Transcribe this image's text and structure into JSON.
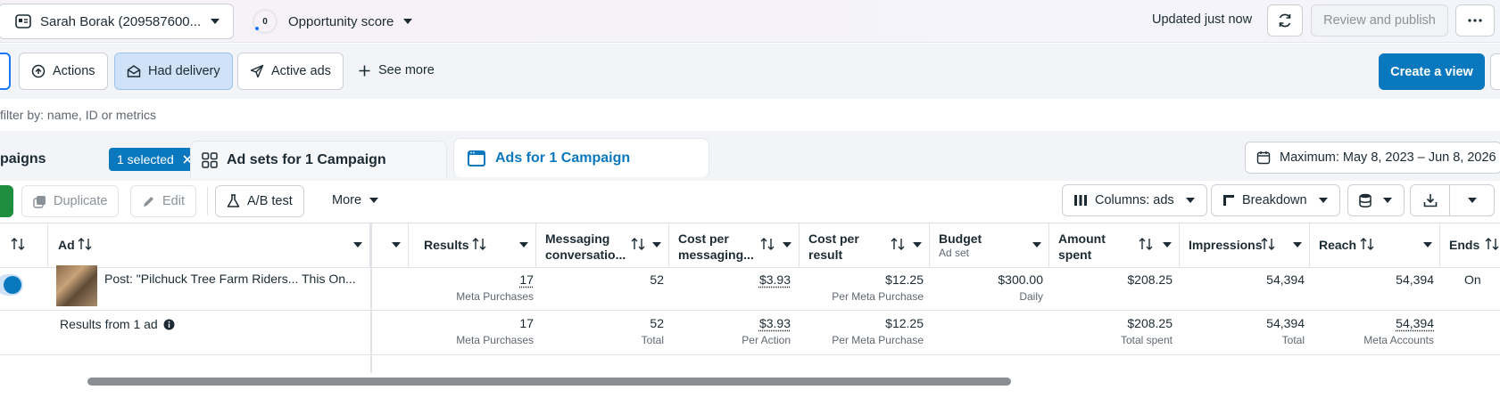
{
  "topbar": {
    "account_label": "Sarah Borak (209587600...",
    "score_value": "0",
    "score_label": "Opportunity score",
    "updated_text": "Updated just now",
    "review_label": "Review and publish"
  },
  "chips": {
    "actions": "Actions",
    "had_delivery": "Had delivery",
    "active_ads": "Active ads",
    "see_more": "See more",
    "create_view": "Create a view"
  },
  "search": {
    "placeholder": "filter by: name, ID or metrics"
  },
  "tabs": {
    "campaigns": "paigns",
    "selected_badge": "1 selected",
    "adsets": "Ad sets for 1 Campaign",
    "ads": "Ads for 1 Campaign",
    "date_range": "Maximum: May 8, 2023 – Jun 8, 2026"
  },
  "toolbar": {
    "duplicate": "Duplicate",
    "edit": "Edit",
    "ab_test": "A/B test",
    "more": "More",
    "columns": "Columns: ads",
    "breakdown": "Breakdown"
  },
  "table": {
    "headers": {
      "ad": "Ad",
      "results": "Results",
      "messaging_1": "Messaging",
      "messaging_2": "conversatio...",
      "cpm_1": "Cost per",
      "cpm_2": "messaging...",
      "cpr_1": "Cost per",
      "cpr_2": "result",
      "budget": "Budget",
      "budget_sub": "Ad set",
      "amount_1": "Amount",
      "amount_2": "spent",
      "impressions": "Impressions",
      "reach": "Reach",
      "ends": "Ends"
    },
    "row": {
      "ad_name": "Post: \"Pilchuck Tree Farm Riders... This On...",
      "results": "17",
      "results_sub": "Meta Purchases",
      "messaging": "52",
      "cost_messaging": "$3.93",
      "cost_result": "$12.25",
      "cost_result_sub": "Per Meta Purchase",
      "budget": "$300.00",
      "budget_sub": "Daily",
      "amount": "$208.25",
      "impressions": "54,394",
      "reach": "54,394",
      "ends": "On"
    },
    "summary": {
      "label": "Results from 1 ad",
      "results": "17",
      "results_sub": "Meta Purchases",
      "messaging": "52",
      "messaging_sub": "Total",
      "cost_messaging": "$3.93",
      "cost_messaging_sub": "Per Action",
      "cost_result": "$12.25",
      "cost_result_sub": "Per Meta Purchase",
      "amount": "$208.25",
      "amount_sub": "Total spent",
      "impressions": "54,394",
      "impressions_sub": "Total",
      "reach": "54,394",
      "reach_sub": "Meta Accounts"
    }
  },
  "colors": {
    "primary": "#0a78be",
    "selected_chip": "#cfe2f7",
    "toggle_on": "#0a78be",
    "green": "#1e8e3e"
  }
}
